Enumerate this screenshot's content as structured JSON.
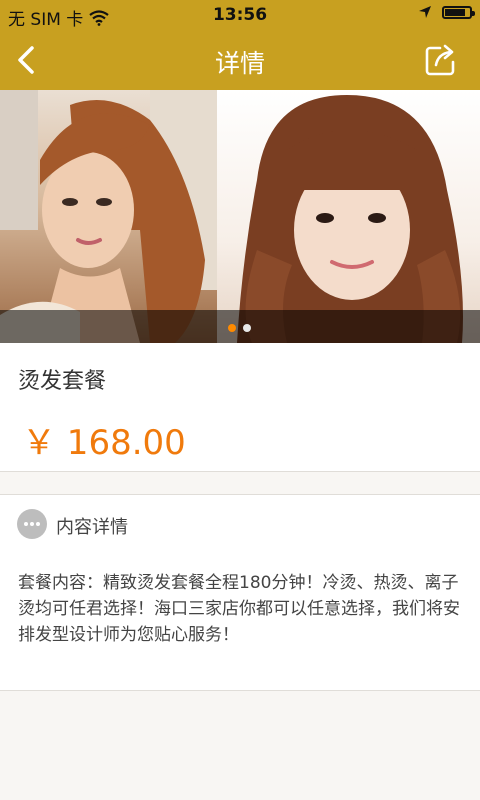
{
  "status_bar": {
    "carrier": "无 SIM 卡",
    "time": "13:56",
    "battery_level": 0.85
  },
  "nav": {
    "title": "详情",
    "back_icon": "chevron-left-icon",
    "share_icon": "share-icon",
    "bar_color": "#c8a020"
  },
  "banner": {
    "slide_count": 2,
    "active_index": 0,
    "active_dot_color": "#ff8a00"
  },
  "product": {
    "name": "烫发套餐",
    "price": "￥ 168.00",
    "price_color": "#f07a0c"
  },
  "detail": {
    "section_label": "内容详情",
    "icon": "more-dots-icon",
    "text": "套餐内容：精致烫发套餐全程180分钟！冷烫、热烫、离子烫均可任君选择！海口三家店你都可以任意选择，我们将安排发型设计师为您贴心服务！"
  }
}
